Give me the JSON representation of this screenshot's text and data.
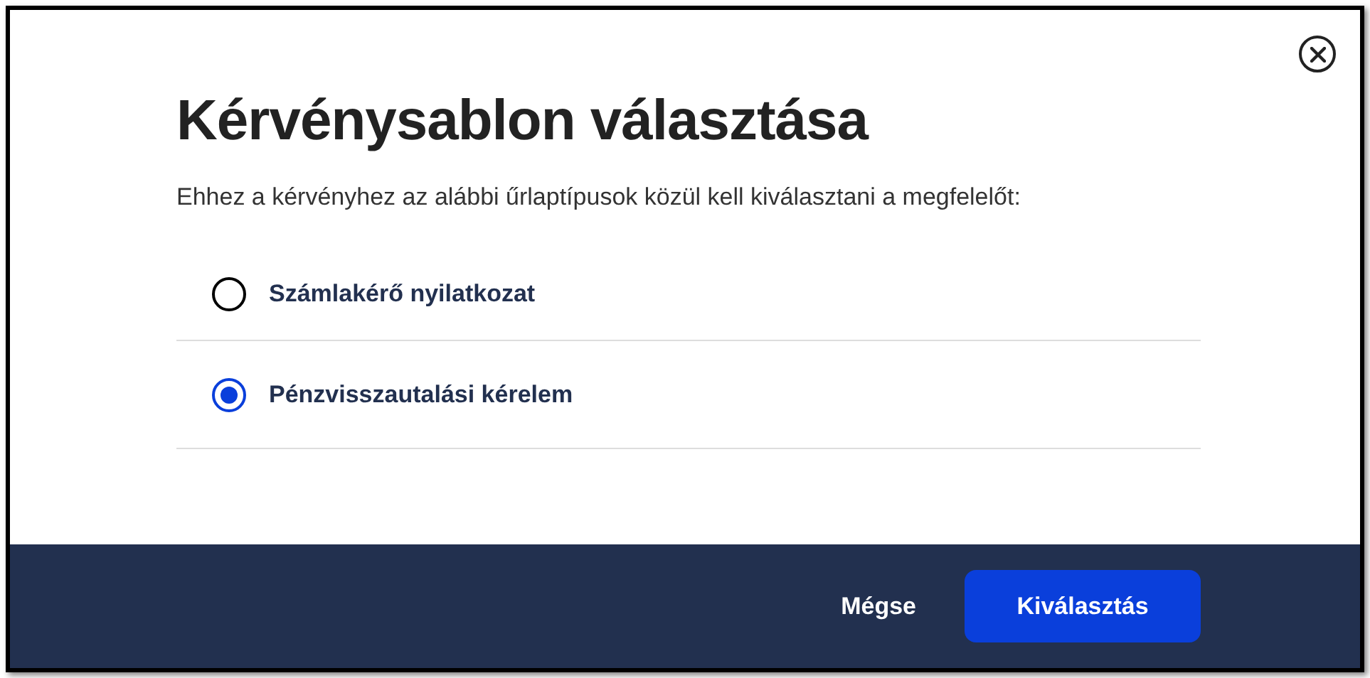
{
  "dialog": {
    "title": "Kérvénysablon választása",
    "description": "Ehhez a kérvényhez az alábbi űrlaptípusok közül kell kiválasztani a megfelelőt:",
    "options": [
      {
        "label": "Számlakérő nyilatkozat",
        "selected": false
      },
      {
        "label": "Pénzvisszautalási kérelem",
        "selected": true
      }
    ],
    "buttons": [
      {
        "label": "Mégse",
        "kind": "secondary"
      },
      {
        "label": "Kiválasztás",
        "kind": "primary"
      }
    ]
  }
}
